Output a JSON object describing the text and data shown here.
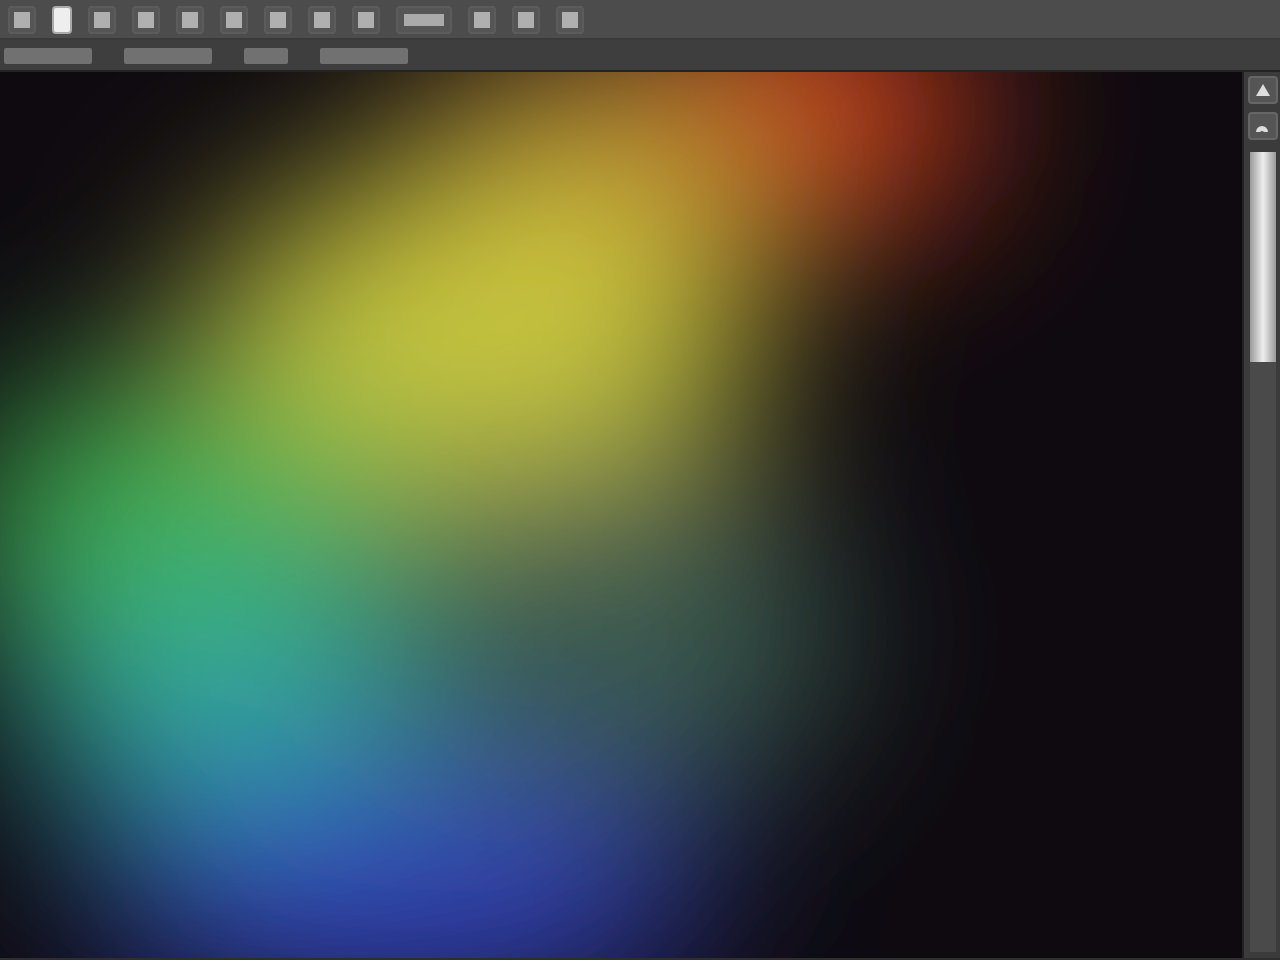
{
  "toolbar": {
    "tools": [
      {
        "kind": "tool"
      },
      {
        "kind": "swatch"
      },
      {
        "kind": "tool"
      },
      {
        "kind": "tool"
      },
      {
        "kind": "tool"
      },
      {
        "kind": "tool"
      },
      {
        "kind": "tool"
      },
      {
        "kind": "tool"
      },
      {
        "kind": "tool"
      },
      {
        "kind": "wide"
      },
      {
        "kind": "tool"
      },
      {
        "kind": "tool"
      },
      {
        "kind": "tool"
      }
    ]
  },
  "options_bar": {
    "items": [
      {
        "kind": "wide"
      },
      {
        "kind": "wide"
      },
      {
        "kind": "tool"
      },
      {
        "kind": "wide"
      }
    ]
  },
  "side_panel": {
    "buttons": [
      {
        "kind": "up"
      },
      {
        "kind": "undo"
      }
    ]
  }
}
